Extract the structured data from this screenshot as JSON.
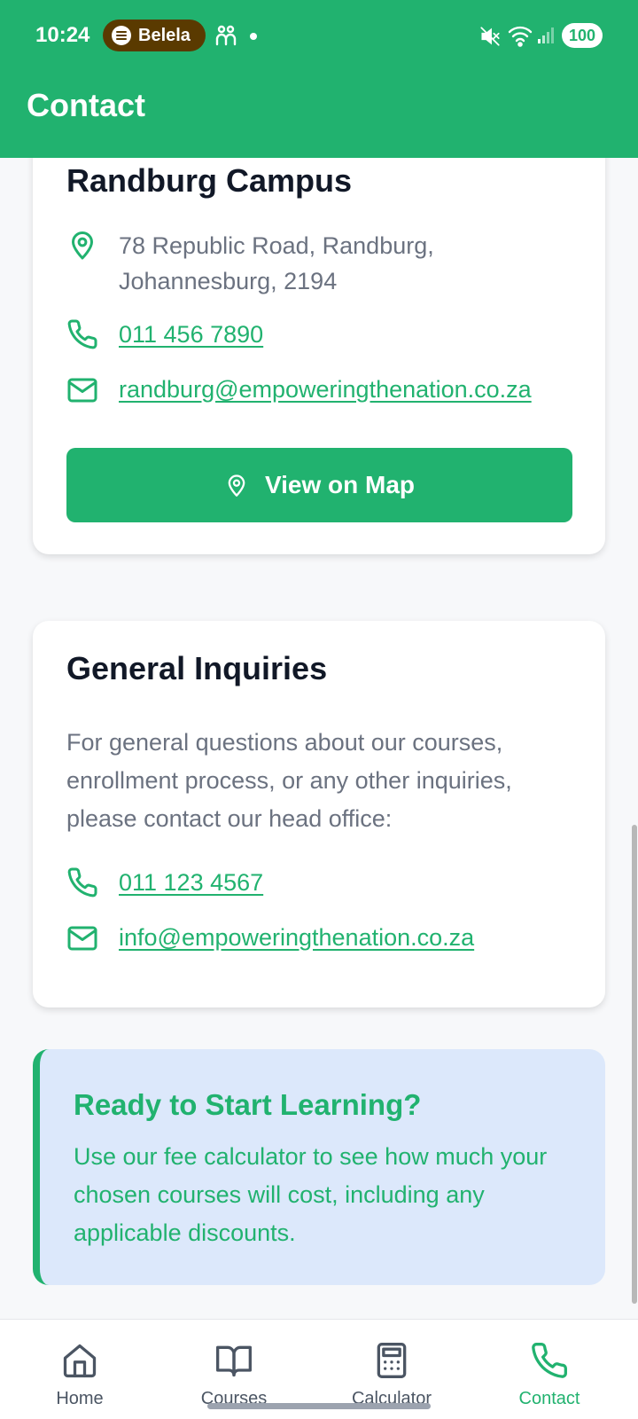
{
  "status_bar": {
    "time": "10:24",
    "media_label": "Belela",
    "battery": "100"
  },
  "header": {
    "title": "Contact"
  },
  "randburg": {
    "title": "Randburg Campus",
    "address_line1": "78 Republic Road, Randburg,",
    "address_line2": "Johannesburg, 2194",
    "phone": "011 456 7890",
    "email": "randburg@empoweringthenation.co.za",
    "map_button": "View on Map"
  },
  "general": {
    "title": "General Inquiries",
    "description": "For general questions about our courses, enrollment process, or any other inquiries, please contact our head office:",
    "phone": "011 123 4567",
    "email": "info@empoweringthenation.co.za"
  },
  "promo": {
    "title": "Ready to Start Learning?",
    "text": "Use our fee calculator to see how much your chosen courses will cost, including any applicable discounts."
  },
  "nav": {
    "items": [
      {
        "label": "Home",
        "icon": "home-icon"
      },
      {
        "label": "Courses",
        "icon": "book-icon"
      },
      {
        "label": "Calculator",
        "icon": "calculator-icon"
      },
      {
        "label": "Contact",
        "icon": "phone-icon"
      }
    ],
    "active": "Contact"
  },
  "colors": {
    "accent": "#21b26f",
    "promo_bg": "#dce8fb",
    "text_muted": "#6b7280"
  }
}
